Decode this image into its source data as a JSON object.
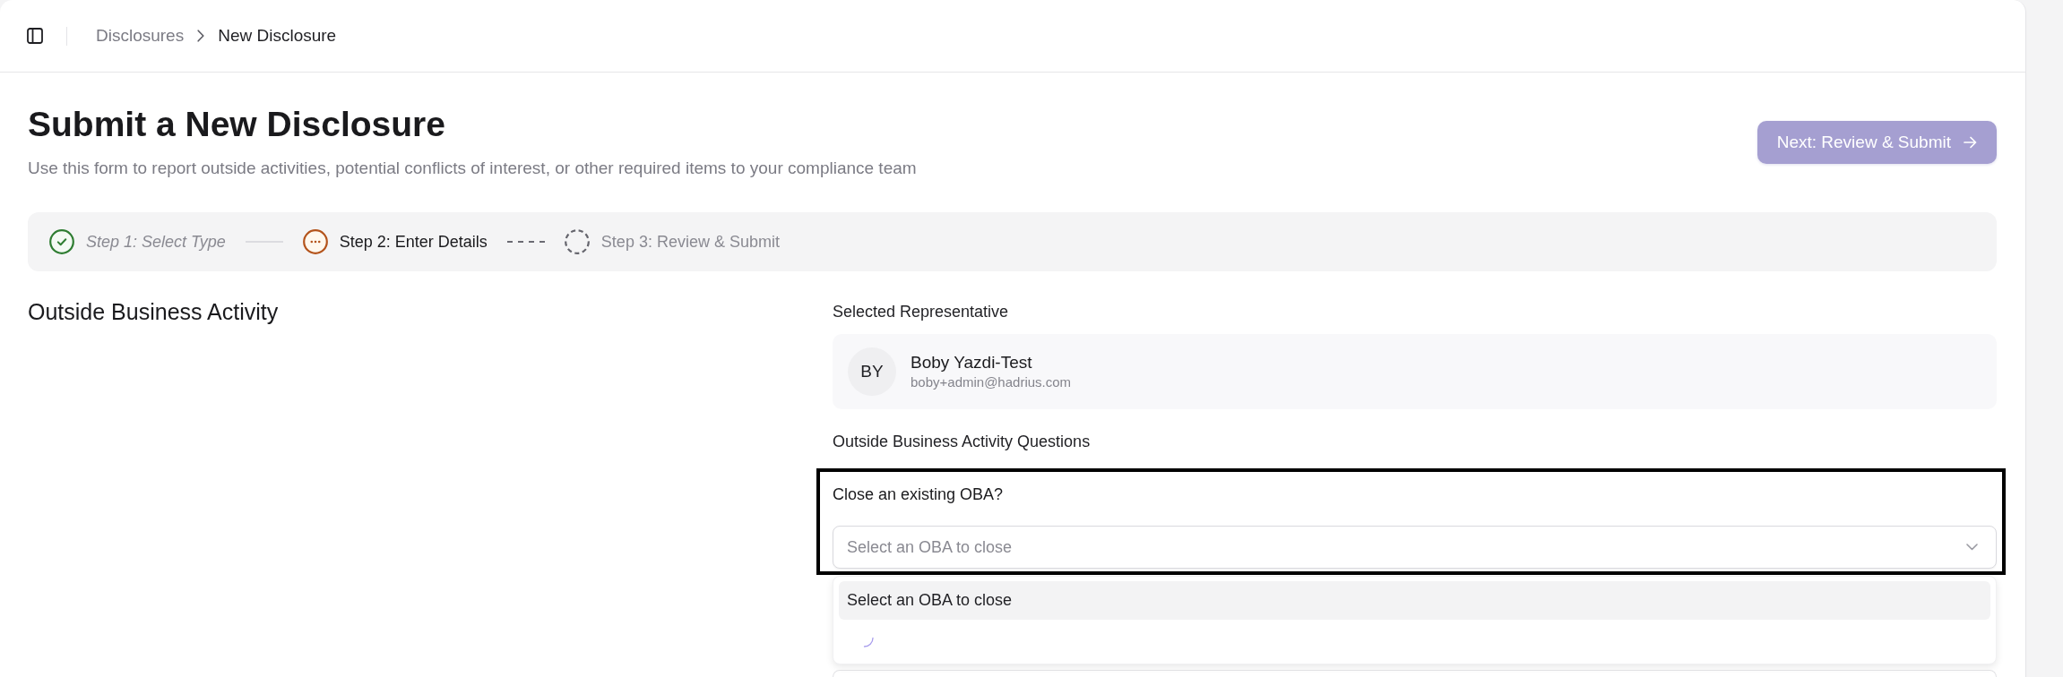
{
  "breadcrumb": [
    {
      "label": "Disclosures",
      "current": false
    },
    {
      "label": "New Disclosure",
      "current": true
    }
  ],
  "header": {
    "title": "Submit a New Disclosure",
    "subtitle": "Use this form to report outside activities, potential conflicts of interest, or other required items to your compliance team",
    "next_button": {
      "label": "Next: Review & Submit",
      "disabled": true
    }
  },
  "steps": [
    {
      "label": "Step 1: Select Type",
      "done": true,
      "current": false
    },
    {
      "label": "Step 2: Enter Details",
      "done": false,
      "current": true
    },
    {
      "label": "Step 3: Review & Submit",
      "done": false,
      "current": false
    }
  ],
  "section_title": "Outside Business Activity",
  "representative": {
    "heading": "Selected Representative",
    "initials": "BY",
    "name": "Boby Yazdi-Test",
    "email": "boby+admin@hadrius.com"
  },
  "questions_heading": "Outside Business Activity Questions",
  "questions": [
    {
      "kind": "select",
      "label": "Close an existing OBA?",
      "placeholder": "Select an OBA to close",
      "highlighted": true,
      "expanded": true,
      "options": [
        {
          "label": "Select an OBA to close",
          "selected": true
        }
      ],
      "loading": true
    },
    {
      "kind": "select"
    }
  ]
}
